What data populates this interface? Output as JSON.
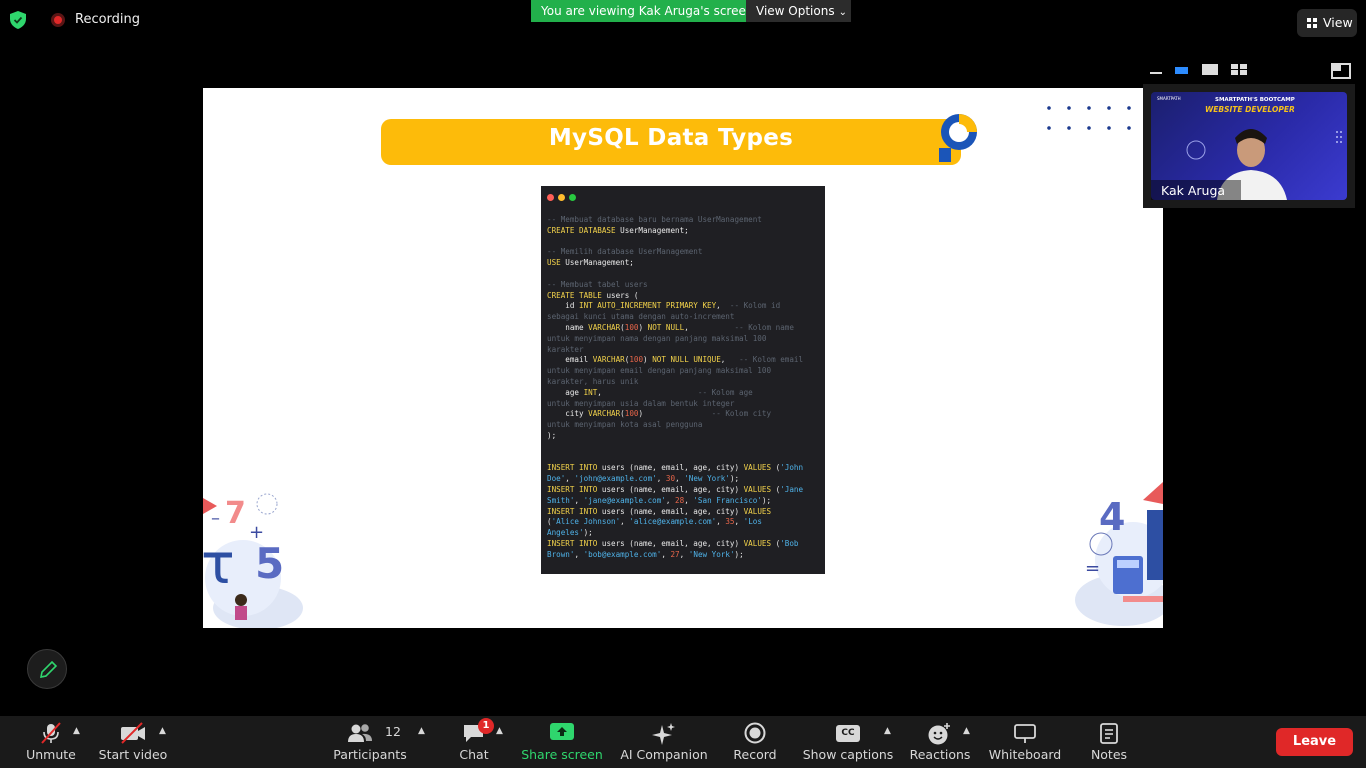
{
  "top_bar": {
    "recording_label": "Recording",
    "viewing_banner": "You are viewing Kak Aruga's screen",
    "view_options_label": "View Options",
    "view_button_label": "View"
  },
  "slide": {
    "title": "MySQL Data Types",
    "code_lines": [
      [
        {
          "t": "-- Membuat database baru bernama UserManagement",
          "c": "cm"
        }
      ],
      [
        {
          "t": "CREATE DATABASE",
          "c": "kw"
        },
        {
          "t": " UserManagement;",
          "c": ""
        }
      ],
      [
        {
          "t": "",
          "c": ""
        }
      ],
      [
        {
          "t": "-- Memilih database UserManagement",
          "c": "cm"
        }
      ],
      [
        {
          "t": "USE",
          "c": "kw"
        },
        {
          "t": " UserManagement;",
          "c": ""
        }
      ],
      [
        {
          "t": "",
          "c": ""
        }
      ],
      [
        {
          "t": "-- Membuat tabel users",
          "c": "cm"
        }
      ],
      [
        {
          "t": "CREATE TABLE",
          "c": "kw"
        },
        {
          "t": " users (",
          "c": ""
        }
      ],
      [
        {
          "t": "    id ",
          "c": ""
        },
        {
          "t": "INT AUTO_INCREMENT PRIMARY KEY",
          "c": "kw"
        },
        {
          "t": ",  ",
          "c": ""
        },
        {
          "t": "-- Kolom id",
          "c": "cm"
        }
      ],
      [
        {
          "t": "sebagai kunci utama dengan auto-increment",
          "c": "cm"
        }
      ],
      [
        {
          "t": "    name ",
          "c": ""
        },
        {
          "t": "VARCHAR",
          "c": "kw"
        },
        {
          "t": "(",
          "c": ""
        },
        {
          "t": "100",
          "c": "nm"
        },
        {
          "t": ") ",
          "c": ""
        },
        {
          "t": "NOT NULL",
          "c": "kw"
        },
        {
          "t": ",          ",
          "c": ""
        },
        {
          "t": "-- Kolom name",
          "c": "cm"
        }
      ],
      [
        {
          "t": "untuk menyimpan nama dengan panjang maksimal 100",
          "c": "cm"
        }
      ],
      [
        {
          "t": "karakter",
          "c": "cm"
        }
      ],
      [
        {
          "t": "    email ",
          "c": ""
        },
        {
          "t": "VARCHAR",
          "c": "kw"
        },
        {
          "t": "(",
          "c": ""
        },
        {
          "t": "100",
          "c": "nm"
        },
        {
          "t": ") ",
          "c": ""
        },
        {
          "t": "NOT NULL UNIQUE",
          "c": "kw"
        },
        {
          "t": ",   ",
          "c": ""
        },
        {
          "t": "-- Kolom email",
          "c": "cm"
        }
      ],
      [
        {
          "t": "untuk menyimpan email dengan panjang maksimal 100",
          "c": "cm"
        }
      ],
      [
        {
          "t": "karakter, harus unik",
          "c": "cm"
        }
      ],
      [
        {
          "t": "    age ",
          "c": ""
        },
        {
          "t": "INT",
          "c": "kw"
        },
        {
          "t": ",                     ",
          "c": ""
        },
        {
          "t": "-- Kolom age",
          "c": "cm"
        }
      ],
      [
        {
          "t": "untuk menyimpan usia dalam bentuk integer",
          "c": "cm"
        }
      ],
      [
        {
          "t": "    city ",
          "c": ""
        },
        {
          "t": "VARCHAR",
          "c": "kw"
        },
        {
          "t": "(",
          "c": ""
        },
        {
          "t": "100",
          "c": "nm"
        },
        {
          "t": ")               ",
          "c": ""
        },
        {
          "t": "-- Kolom city",
          "c": "cm"
        }
      ],
      [
        {
          "t": "untuk menyimpan kota asal pengguna",
          "c": "cm"
        }
      ],
      [
        {
          "t": ");",
          "c": ""
        }
      ],
      [
        {
          "t": "",
          "c": ""
        }
      ],
      [
        {
          "t": "",
          "c": ""
        }
      ],
      [
        {
          "t": "INSERT INTO",
          "c": "kw"
        },
        {
          "t": " users (name, email, age, city) ",
          "c": ""
        },
        {
          "t": "VALUES",
          "c": "kw"
        },
        {
          "t": " (",
          "c": ""
        },
        {
          "t": "'John",
          "c": "st"
        }
      ],
      [
        {
          "t": "Doe'",
          "c": "st"
        },
        {
          "t": ", ",
          "c": ""
        },
        {
          "t": "'john@example.com'",
          "c": "st"
        },
        {
          "t": ", ",
          "c": ""
        },
        {
          "t": "30",
          "c": "nm"
        },
        {
          "t": ", ",
          "c": ""
        },
        {
          "t": "'New York'",
          "c": "st"
        },
        {
          "t": ");",
          "c": ""
        }
      ],
      [
        {
          "t": "INSERT INTO",
          "c": "kw"
        },
        {
          "t": " users (name, email, age, city) ",
          "c": ""
        },
        {
          "t": "VALUES",
          "c": "kw"
        },
        {
          "t": " (",
          "c": ""
        },
        {
          "t": "'Jane",
          "c": "st"
        }
      ],
      [
        {
          "t": "Smith'",
          "c": "st"
        },
        {
          "t": ", ",
          "c": ""
        },
        {
          "t": "'jane@example.com'",
          "c": "st"
        },
        {
          "t": ", ",
          "c": ""
        },
        {
          "t": "28",
          "c": "nm"
        },
        {
          "t": ", ",
          "c": ""
        },
        {
          "t": "'San Francisco'",
          "c": "st"
        },
        {
          "t": ");",
          "c": ""
        }
      ],
      [
        {
          "t": "INSERT INTO",
          "c": "kw"
        },
        {
          "t": " users (name, email, age, city) ",
          "c": ""
        },
        {
          "t": "VALUES",
          "c": "kw"
        }
      ],
      [
        {
          "t": "(",
          "c": ""
        },
        {
          "t": "'Alice Johnson'",
          "c": "st"
        },
        {
          "t": ", ",
          "c": ""
        },
        {
          "t": "'alice@example.com'",
          "c": "st"
        },
        {
          "t": ", ",
          "c": ""
        },
        {
          "t": "35",
          "c": "nm"
        },
        {
          "t": ", ",
          "c": ""
        },
        {
          "t": "'Los",
          "c": "st"
        }
      ],
      [
        {
          "t": "Angeles'",
          "c": "st"
        },
        {
          "t": ");",
          "c": ""
        }
      ],
      [
        {
          "t": "INSERT INTO",
          "c": "kw"
        },
        {
          "t": " users (name, email, age, city) ",
          "c": ""
        },
        {
          "t": "VALUES",
          "c": "kw"
        },
        {
          "t": " (",
          "c": ""
        },
        {
          "t": "'Bob",
          "c": "st"
        }
      ],
      [
        {
          "t": "Brown'",
          "c": "st"
        },
        {
          "t": ", ",
          "c": ""
        },
        {
          "t": "'bob@example.com'",
          "c": "st"
        },
        {
          "t": ", ",
          "c": ""
        },
        {
          "t": "27",
          "c": "nm"
        },
        {
          "t": ", ",
          "c": ""
        },
        {
          "t": "'New York'",
          "c": "st"
        },
        {
          "t": ");",
          "c": ""
        }
      ]
    ]
  },
  "video": {
    "participant_name": "Kak Aruga",
    "banner_top": "SMARTPATH'S BOOTCAMP",
    "banner_main": "WEBSITE DEVELOPER",
    "brand": "SMARTPATH"
  },
  "toolbar": {
    "unmute": "Unmute",
    "start_video": "Start video",
    "participants": "Participants",
    "participants_count": "12",
    "chat": "Chat",
    "chat_badge": "1",
    "share_screen": "Share screen",
    "ai_companion": "AI Companion",
    "record": "Record",
    "show_captions": "Show captions",
    "captions_icon_text": "CC",
    "reactions": "Reactions",
    "whiteboard": "Whiteboard",
    "notes": "Notes",
    "leave": "Leave"
  },
  "colors": {
    "share_green": "#2fd66d",
    "leave_red": "#e02828",
    "slide_title_yellow": "#fdbb0a",
    "viewing_green": "#22b04b"
  }
}
